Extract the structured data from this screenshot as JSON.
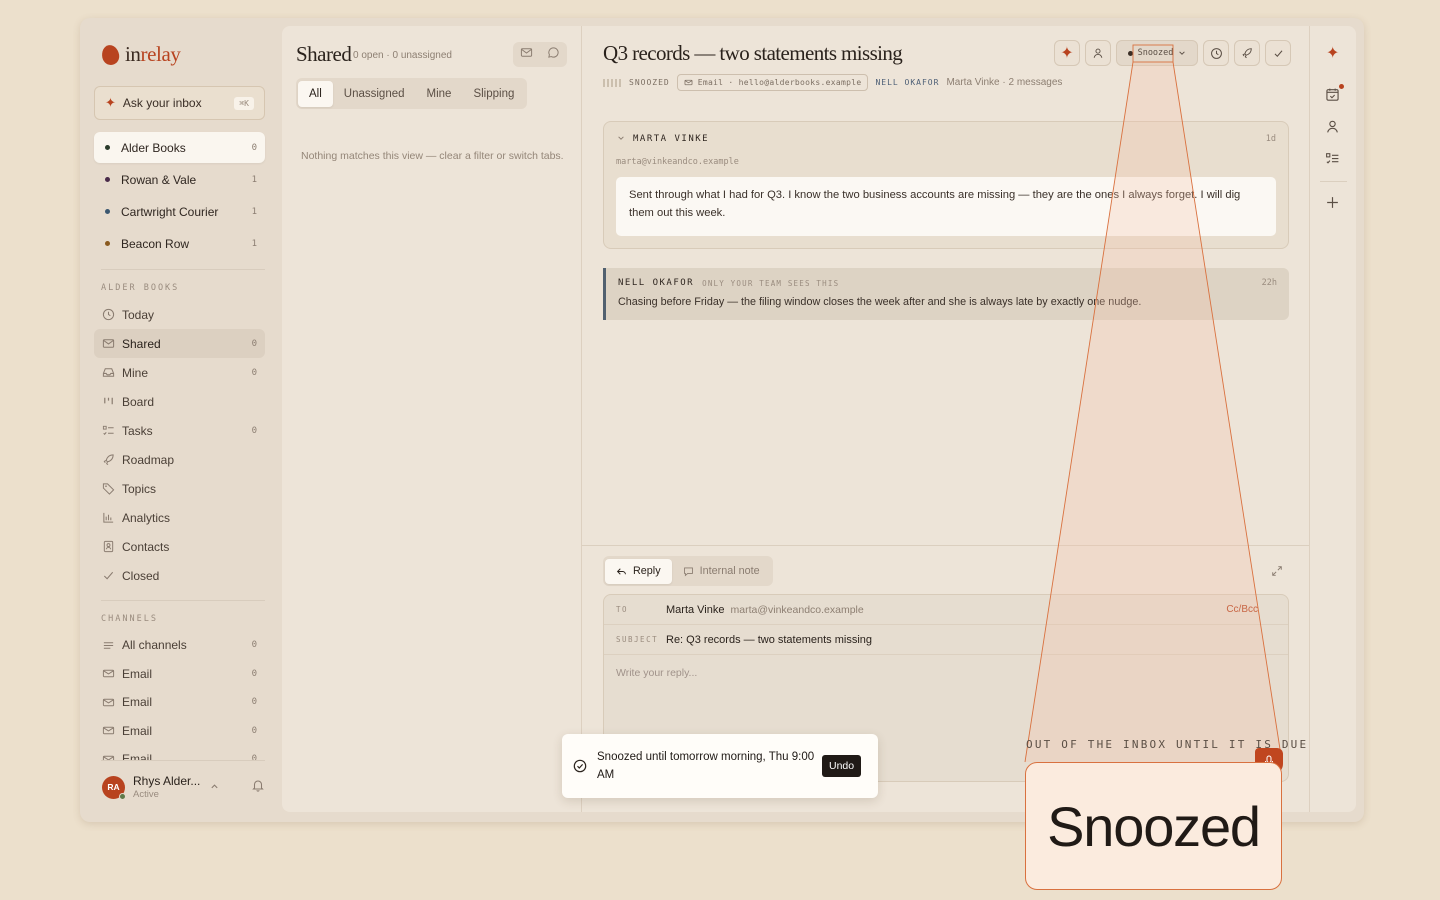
{
  "brand": {
    "name_plain": "in",
    "name_accent": "relay"
  },
  "ask": {
    "label": "Ask your inbox",
    "shortcut": "⌘K"
  },
  "inboxes": [
    {
      "name": "Alder Books",
      "count": "0",
      "color": "#2a3a2a"
    },
    {
      "name": "Rowan & Vale",
      "count": "1",
      "color": "#4a2b4a"
    },
    {
      "name": "Cartwright Courier",
      "count": "1",
      "color": "#3b5770"
    },
    {
      "name": "Beacon Row",
      "count": "1",
      "color": "#8a5a1f"
    }
  ],
  "section_alder": "ALDER BOOKS",
  "nav": [
    {
      "label": "Today",
      "count": "",
      "icon": "clock-icon"
    },
    {
      "label": "Shared",
      "count": "0",
      "icon": "mail-icon"
    },
    {
      "label": "Mine",
      "count": "0",
      "icon": "inbox-icon"
    },
    {
      "label": "Board",
      "count": "",
      "icon": "board-icon"
    },
    {
      "label": "Tasks",
      "count": "0",
      "icon": "tasks-icon"
    },
    {
      "label": "Roadmap",
      "count": "",
      "icon": "rocket-icon"
    },
    {
      "label": "Topics",
      "count": "",
      "icon": "tag-icon"
    },
    {
      "label": "Analytics",
      "count": "",
      "icon": "chart-icon"
    },
    {
      "label": "Contacts",
      "count": "",
      "icon": "contacts-icon"
    },
    {
      "label": "Closed",
      "count": "",
      "icon": "check-icon"
    }
  ],
  "section_channels": "CHANNELS",
  "channels": [
    {
      "label": "All channels",
      "count": "0"
    },
    {
      "label": "Email",
      "count": "0"
    },
    {
      "label": "Email",
      "count": "0"
    },
    {
      "label": "Email",
      "count": "0"
    },
    {
      "label": "Email",
      "count": "0"
    }
  ],
  "user": {
    "initials": "RA",
    "name": "Rhys Alder...",
    "status": "Active"
  },
  "list": {
    "title": "Shared",
    "subtitle": "0 open · 0 unassigned",
    "tabs": [
      "All",
      "Unassigned",
      "Mine",
      "Slipping"
    ],
    "empty": "Nothing matches this view — clear a filter or switch tabs."
  },
  "thread": {
    "title": "Q3 records — two statements missing",
    "status_tag": "SNOOZED",
    "channel": "Email · hello@alderbooks.example",
    "assignee": "NELL OKAFOR",
    "contact_summary": "Marta Vinke · 2 messages",
    "status_button": "Snoozed"
  },
  "message": {
    "sender": "MARTA VINKE",
    "time": "1d",
    "address": "marta@vinkeandco.example",
    "body": "Sent through what I had for Q3. I know the two business accounts are missing — they are the ones I always forget. I will dig them out this week."
  },
  "note": {
    "author": "NELL OKAFOR",
    "visibility": "ONLY YOUR TEAM SEES THIS",
    "time": "22h",
    "text": "Chasing before Friday — the filing window closes the week after and she is always late by exactly one nudge."
  },
  "composer": {
    "reply_tab": "Reply",
    "note_tab": "Internal note",
    "to_label": "TO",
    "to_name": "Marta Vinke",
    "to_addr": "marta@vinkeandco.example",
    "ccbcc": "Cc/Bcc",
    "subject_label": "SUBJECT",
    "subject": "Re: Q3 records — two statements missing",
    "placeholder": "Write your reply..."
  },
  "toast": {
    "message": "Snoozed until tomorrow morning, Thu 9:00 AM",
    "undo": "Undo"
  },
  "callout": {
    "caption": "OUT OF THE INBOX UNTIL IT IS DUE",
    "zoom_text": "Snoozed"
  }
}
